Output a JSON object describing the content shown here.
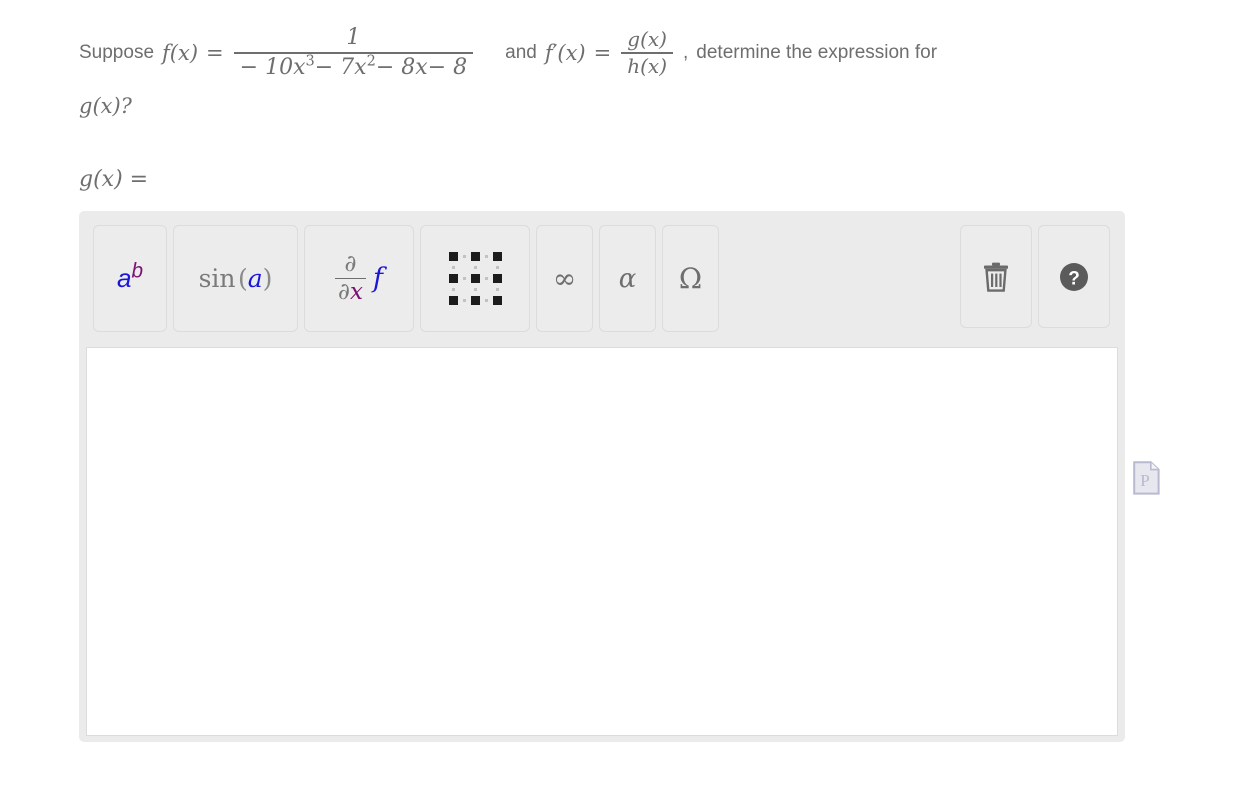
{
  "question": {
    "lead": "Suppose",
    "f_label": "f(x)",
    "equals": "=",
    "f_numerator": "1",
    "f_denominator_terms": "−10 x³ −7 x² −8 x −8",
    "f_den_c1": "− 10",
    "f_den_x1": "x",
    "f_den_p1": "3",
    "f_den_c2": "− 7",
    "f_den_x2": "x",
    "f_den_p2": "2",
    "f_den_c3": "− 8",
    "f_den_x3": "x",
    "f_den_c4": "− 8",
    "conjunction": "and",
    "fprime_label": "f′(x)",
    "fprime_numerator": "g(x)",
    "fprime_denominator": "h(x)",
    "comma": ",",
    "tail": "determine the expression for",
    "line2": "g(x)?"
  },
  "answer": {
    "label": "g(x) =",
    "value": "",
    "placeholder": ""
  },
  "toolbar": {
    "buttons": [
      {
        "name": "exponent",
        "icon": "a-superscript-b-icon",
        "base": "a",
        "exp": "b"
      },
      {
        "name": "trig-function",
        "icon": "sin-function-icon",
        "fn": "sin",
        "open": "(",
        "arg": "a",
        "close": ")"
      },
      {
        "name": "partial-derivative",
        "icon": "partial-derivative-icon",
        "num": "∂",
        "den_d": "∂",
        "den_x": "x",
        "fn": "f"
      },
      {
        "name": "matrix",
        "icon": "matrix-grid-icon"
      },
      {
        "name": "infinity",
        "icon": "infinity-icon",
        "glyph": "∞"
      },
      {
        "name": "greek-alpha",
        "icon": "alpha-icon",
        "glyph": "α"
      },
      {
        "name": "greek-omega",
        "icon": "omega-icon",
        "glyph": "Ω"
      }
    ],
    "right_buttons": [
      {
        "name": "clear",
        "icon": "trash-icon"
      },
      {
        "name": "help",
        "icon": "help-question-icon",
        "glyph": "?"
      }
    ]
  },
  "side": {
    "page_icon": "page-document-icon",
    "page_icon_letter": "P"
  },
  "colors": {
    "text": "#6e6e6e",
    "panel": "#ebebeb",
    "button": "#ececec",
    "button_border": "#dcdcdc",
    "var_blue": "#1a16d8",
    "var_purple": "#7b1470",
    "icon_dark": "#555555",
    "page_icon": "#b9b9cf"
  }
}
